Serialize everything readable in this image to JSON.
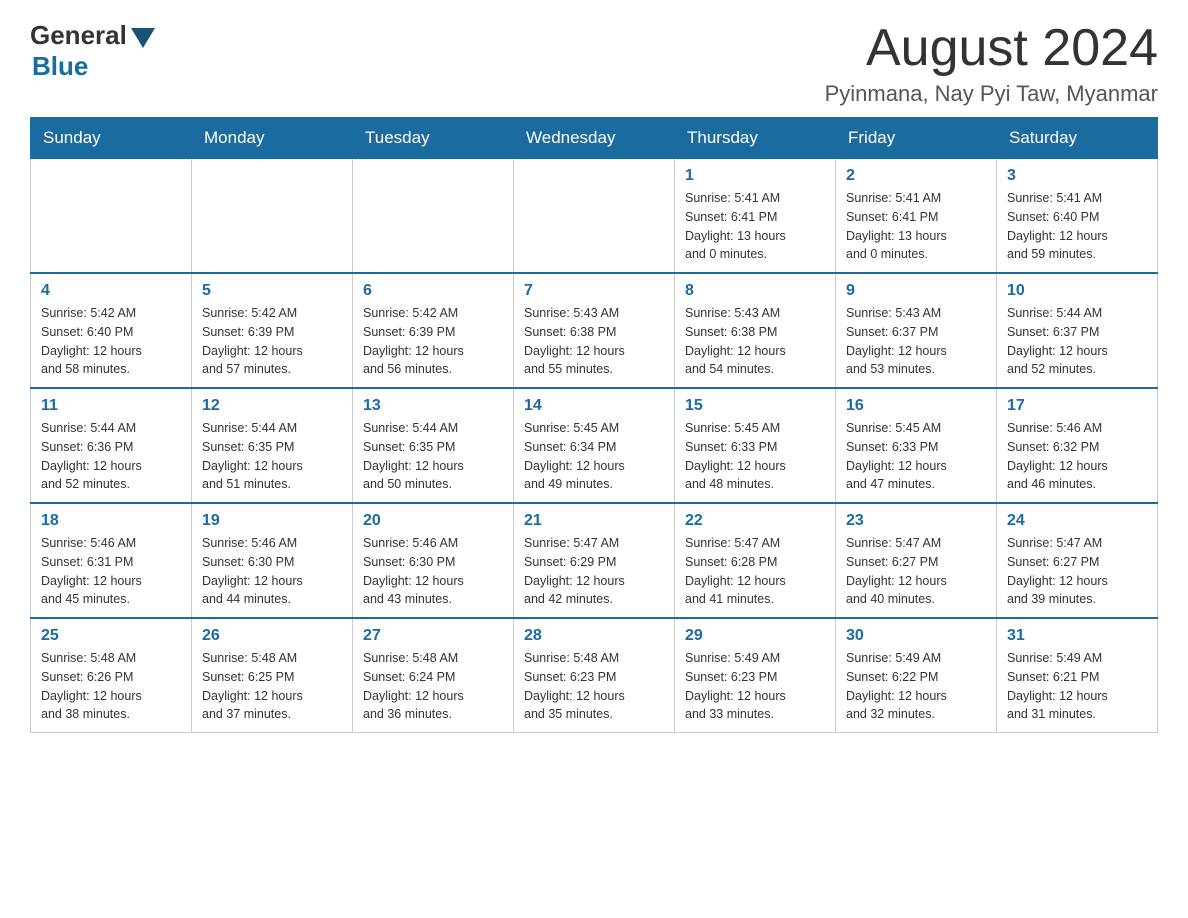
{
  "header": {
    "logo_general": "General",
    "logo_blue": "Blue",
    "month_title": "August 2024",
    "location": "Pyinmana, Nay Pyi Taw, Myanmar"
  },
  "weekdays": [
    "Sunday",
    "Monday",
    "Tuesday",
    "Wednesday",
    "Thursday",
    "Friday",
    "Saturday"
  ],
  "weeks": [
    [
      {
        "day": "",
        "info": ""
      },
      {
        "day": "",
        "info": ""
      },
      {
        "day": "",
        "info": ""
      },
      {
        "day": "",
        "info": ""
      },
      {
        "day": "1",
        "info": "Sunrise: 5:41 AM\nSunset: 6:41 PM\nDaylight: 13 hours\nand 0 minutes."
      },
      {
        "day": "2",
        "info": "Sunrise: 5:41 AM\nSunset: 6:41 PM\nDaylight: 13 hours\nand 0 minutes."
      },
      {
        "day": "3",
        "info": "Sunrise: 5:41 AM\nSunset: 6:40 PM\nDaylight: 12 hours\nand 59 minutes."
      }
    ],
    [
      {
        "day": "4",
        "info": "Sunrise: 5:42 AM\nSunset: 6:40 PM\nDaylight: 12 hours\nand 58 minutes."
      },
      {
        "day": "5",
        "info": "Sunrise: 5:42 AM\nSunset: 6:39 PM\nDaylight: 12 hours\nand 57 minutes."
      },
      {
        "day": "6",
        "info": "Sunrise: 5:42 AM\nSunset: 6:39 PM\nDaylight: 12 hours\nand 56 minutes."
      },
      {
        "day": "7",
        "info": "Sunrise: 5:43 AM\nSunset: 6:38 PM\nDaylight: 12 hours\nand 55 minutes."
      },
      {
        "day": "8",
        "info": "Sunrise: 5:43 AM\nSunset: 6:38 PM\nDaylight: 12 hours\nand 54 minutes."
      },
      {
        "day": "9",
        "info": "Sunrise: 5:43 AM\nSunset: 6:37 PM\nDaylight: 12 hours\nand 53 minutes."
      },
      {
        "day": "10",
        "info": "Sunrise: 5:44 AM\nSunset: 6:37 PM\nDaylight: 12 hours\nand 52 minutes."
      }
    ],
    [
      {
        "day": "11",
        "info": "Sunrise: 5:44 AM\nSunset: 6:36 PM\nDaylight: 12 hours\nand 52 minutes."
      },
      {
        "day": "12",
        "info": "Sunrise: 5:44 AM\nSunset: 6:35 PM\nDaylight: 12 hours\nand 51 minutes."
      },
      {
        "day": "13",
        "info": "Sunrise: 5:44 AM\nSunset: 6:35 PM\nDaylight: 12 hours\nand 50 minutes."
      },
      {
        "day": "14",
        "info": "Sunrise: 5:45 AM\nSunset: 6:34 PM\nDaylight: 12 hours\nand 49 minutes."
      },
      {
        "day": "15",
        "info": "Sunrise: 5:45 AM\nSunset: 6:33 PM\nDaylight: 12 hours\nand 48 minutes."
      },
      {
        "day": "16",
        "info": "Sunrise: 5:45 AM\nSunset: 6:33 PM\nDaylight: 12 hours\nand 47 minutes."
      },
      {
        "day": "17",
        "info": "Sunrise: 5:46 AM\nSunset: 6:32 PM\nDaylight: 12 hours\nand 46 minutes."
      }
    ],
    [
      {
        "day": "18",
        "info": "Sunrise: 5:46 AM\nSunset: 6:31 PM\nDaylight: 12 hours\nand 45 minutes."
      },
      {
        "day": "19",
        "info": "Sunrise: 5:46 AM\nSunset: 6:30 PM\nDaylight: 12 hours\nand 44 minutes."
      },
      {
        "day": "20",
        "info": "Sunrise: 5:46 AM\nSunset: 6:30 PM\nDaylight: 12 hours\nand 43 minutes."
      },
      {
        "day": "21",
        "info": "Sunrise: 5:47 AM\nSunset: 6:29 PM\nDaylight: 12 hours\nand 42 minutes."
      },
      {
        "day": "22",
        "info": "Sunrise: 5:47 AM\nSunset: 6:28 PM\nDaylight: 12 hours\nand 41 minutes."
      },
      {
        "day": "23",
        "info": "Sunrise: 5:47 AM\nSunset: 6:27 PM\nDaylight: 12 hours\nand 40 minutes."
      },
      {
        "day": "24",
        "info": "Sunrise: 5:47 AM\nSunset: 6:27 PM\nDaylight: 12 hours\nand 39 minutes."
      }
    ],
    [
      {
        "day": "25",
        "info": "Sunrise: 5:48 AM\nSunset: 6:26 PM\nDaylight: 12 hours\nand 38 minutes."
      },
      {
        "day": "26",
        "info": "Sunrise: 5:48 AM\nSunset: 6:25 PM\nDaylight: 12 hours\nand 37 minutes."
      },
      {
        "day": "27",
        "info": "Sunrise: 5:48 AM\nSunset: 6:24 PM\nDaylight: 12 hours\nand 36 minutes."
      },
      {
        "day": "28",
        "info": "Sunrise: 5:48 AM\nSunset: 6:23 PM\nDaylight: 12 hours\nand 35 minutes."
      },
      {
        "day": "29",
        "info": "Sunrise: 5:49 AM\nSunset: 6:23 PM\nDaylight: 12 hours\nand 33 minutes."
      },
      {
        "day": "30",
        "info": "Sunrise: 5:49 AM\nSunset: 6:22 PM\nDaylight: 12 hours\nand 32 minutes."
      },
      {
        "day": "31",
        "info": "Sunrise: 5:49 AM\nSunset: 6:21 PM\nDaylight: 12 hours\nand 31 minutes."
      }
    ]
  ]
}
